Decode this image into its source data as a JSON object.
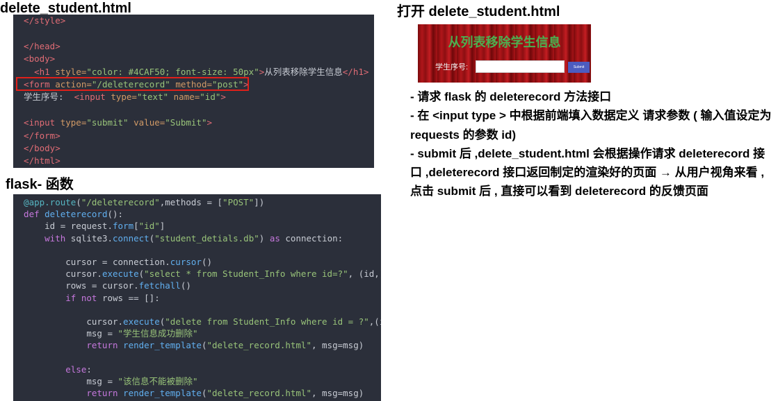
{
  "left_title": "delete_student.html",
  "html_code": [
    [
      [
        "c-tag",
        "  </style>"
      ]
    ],
    [],
    [
      [
        "c-tag",
        "  </head>"
      ]
    ],
    [
      [
        "c-tag",
        "  <body>"
      ]
    ],
    [
      [
        "c-tag",
        "    <h1 "
      ],
      [
        "c-attr",
        "style="
      ],
      [
        "c-str",
        "\"color: #4CAF50; font-size: 50px\""
      ],
      [
        "c-tag",
        ">"
      ],
      [
        "c-text",
        "从列表移除学生信息"
      ],
      [
        "c-tag",
        "</h1>"
      ]
    ],
    [
      [
        "c-tag",
        "  <form "
      ],
      [
        "c-attr",
        "action="
      ],
      [
        "c-str",
        "\"/deleterecord\""
      ],
      [
        "c-attr",
        " method="
      ],
      [
        "c-str",
        "\"post\""
      ],
      [
        "c-tag",
        ">"
      ]
    ],
    [
      [
        "c-text",
        "  学生序号:  "
      ],
      [
        "c-tag",
        "<input "
      ],
      [
        "c-attr",
        "type="
      ],
      [
        "c-str",
        "\"text\""
      ],
      [
        "c-attr",
        " name="
      ],
      [
        "c-str",
        "\"id\""
      ],
      [
        "c-tag",
        ">"
      ]
    ],
    [],
    [
      [
        "c-tag",
        "  <input "
      ],
      [
        "c-attr",
        "type="
      ],
      [
        "c-str",
        "\"submit\""
      ],
      [
        "c-attr",
        " value="
      ],
      [
        "c-str",
        "\"Submit\""
      ],
      [
        "c-tag",
        ">"
      ]
    ],
    [
      [
        "c-tag",
        "  </form>"
      ]
    ],
    [
      [
        "c-tag",
        "  </body>"
      ]
    ],
    [
      [
        "c-tag",
        "  </html>"
      ]
    ]
  ],
  "flask_title": "flask- 函数",
  "flask_code": [
    [
      [
        "c-dec",
        "  @app.route"
      ],
      [
        "c-text",
        "("
      ],
      [
        "c-str",
        "\"/deleterecord\""
      ],
      [
        "c-text",
        ",methods = ["
      ],
      [
        "c-str",
        "\"POST\""
      ],
      [
        "c-text",
        "])"
      ]
    ],
    [
      [
        "c-kw",
        "  def "
      ],
      [
        "c-fn",
        "deleterecord"
      ],
      [
        "c-text",
        "():"
      ]
    ],
    [
      [
        "c-text",
        "      id = request."
      ],
      [
        "c-fn",
        "form"
      ],
      [
        "c-text",
        "["
      ],
      [
        "c-str",
        "\"id\""
      ],
      [
        "c-text",
        "]"
      ]
    ],
    [
      [
        "c-kw",
        "      with "
      ],
      [
        "c-text",
        "sqlite3."
      ],
      [
        "c-fn",
        "connect"
      ],
      [
        "c-text",
        "("
      ],
      [
        "c-str",
        "\"student_detials.db\""
      ],
      [
        "c-text",
        ") "
      ],
      [
        "c-kw",
        "as"
      ],
      [
        "c-text",
        " connection:"
      ]
    ],
    [],
    [
      [
        "c-text",
        "          cursor = connection."
      ],
      [
        "c-fn",
        "cursor"
      ],
      [
        "c-text",
        "()"
      ]
    ],
    [
      [
        "c-text",
        "          cursor."
      ],
      [
        "c-fn",
        "execute"
      ],
      [
        "c-text",
        "("
      ],
      [
        "c-str",
        "\"select * from Student_Info where id=?\""
      ],
      [
        "c-text",
        ", (id,))"
      ]
    ],
    [
      [
        "c-text",
        "          rows = cursor."
      ],
      [
        "c-fn",
        "fetchall"
      ],
      [
        "c-text",
        "()"
      ]
    ],
    [
      [
        "c-kw",
        "          if not "
      ],
      [
        "c-text",
        "rows == []:"
      ]
    ],
    [],
    [
      [
        "c-text",
        "              cursor."
      ],
      [
        "c-fn",
        "execute"
      ],
      [
        "c-text",
        "("
      ],
      [
        "c-str",
        "\"delete from Student_Info where id = ?\""
      ],
      [
        "c-text",
        ",(id,))"
      ]
    ],
    [
      [
        "c-text",
        "              msg = "
      ],
      [
        "c-str",
        "\"学生信息成功删除\""
      ]
    ],
    [
      [
        "c-kw",
        "              return "
      ],
      [
        "c-fn",
        "render_template"
      ],
      [
        "c-text",
        "("
      ],
      [
        "c-str",
        "\"delete_record.html\""
      ],
      [
        "c-text",
        ", msg=msg)"
      ]
    ],
    [],
    [
      [
        "c-kw",
        "          else"
      ],
      [
        "c-text",
        ":"
      ]
    ],
    [
      [
        "c-text",
        "              msg = "
      ],
      [
        "c-str",
        "\"该信息不能被删除\""
      ]
    ],
    [
      [
        "c-kw",
        "              return "
      ],
      [
        "c-fn",
        "render_template"
      ],
      [
        "c-text",
        "("
      ],
      [
        "c-str",
        "\"delete_record.html\""
      ],
      [
        "c-text",
        ", msg=msg)"
      ]
    ]
  ],
  "right_title": "打开   delete_student.html",
  "preview": {
    "title": "从列表移除学生信息",
    "label": "学生序号:",
    "submit": "Submit"
  },
  "notes": [
    "-  请求  flask 的 deleterecord 方法接口",
    "-  在 <input type >  中根据前端填入数据定义 请求参数 ( 输入值设定为 requests 的参数 id)",
    "- submit 后 ,delete_student.html 会根据操作请求 deleterecord 接口 ,deleterecord 接口返回制定的渲染好的页面 → 从用户视角来看 , 点击 submit 后 , 直接可以看到 deleterecord 的反馈页面"
  ]
}
